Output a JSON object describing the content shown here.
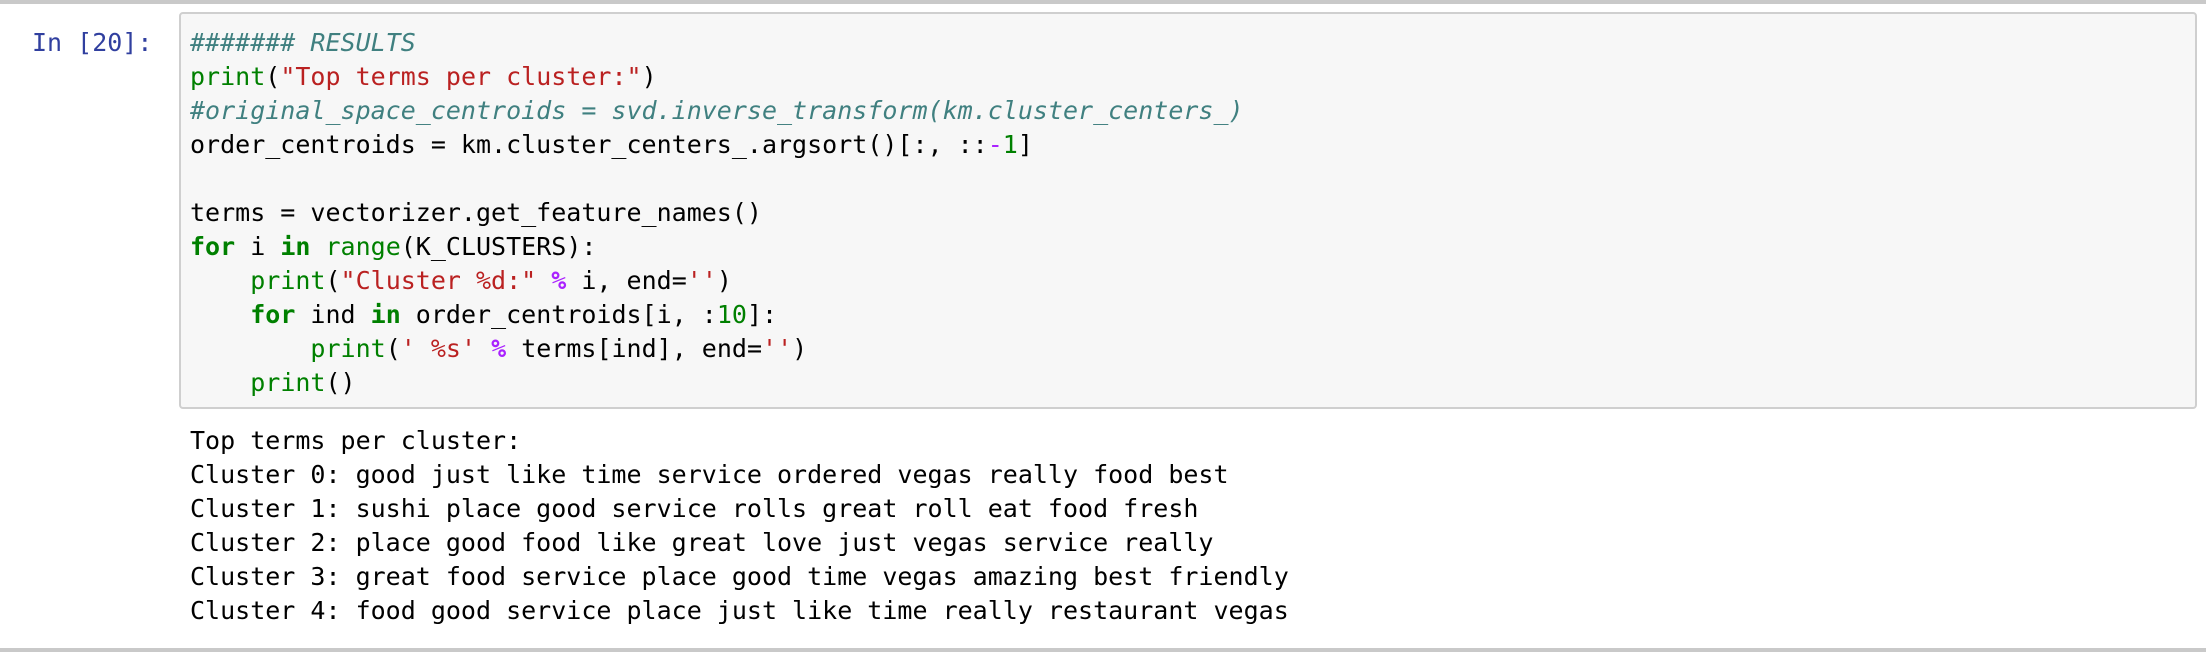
{
  "cell": {
    "prompt": "In [20]:",
    "code": {
      "comment_results": "####### RESULTS",
      "print_fn": "print",
      "open_paren": "(",
      "str_top_terms": "\"Top terms per cluster:\"",
      "close_paren": ")",
      "comment_original": "#original_space_centroids = svd.inverse_transform(km.cluster_centers_)",
      "order_prefix": "order_centroids = km.cluster_centers_.argsort()[:, ::",
      "minus": "-",
      "one": "1",
      "close_bracket": "]",
      "terms_line": "terms = vectorizer.get_feature_names()",
      "kw_for": "for",
      "var_i": " i ",
      "kw_in": "in",
      "space": " ",
      "range_fn": "range",
      "range_args": "(K_CLUSTERS):",
      "indent4": "    ",
      "indent8": "        ",
      "str_cluster": "\"Cluster %d:\"",
      "op_percent": "%",
      "print_args_i": " i, end=",
      "str_empty": "''",
      "var_ind": " ind ",
      "inner_for_rest": " order_centroids[i, :",
      "ten": "10",
      "inner_for_end": "]:",
      "str_term": "' %s'",
      "print_args_terms": " terms[ind], end=",
      "print_empty_call": "()"
    }
  },
  "output": {
    "lines": [
      "Top terms per cluster:",
      "Cluster 0: good just like time service ordered vegas really food best",
      "Cluster 1: sushi place good service rolls great roll eat food fresh",
      "Cluster 2: place good food like great love just vegas service really",
      "Cluster 3: great food service place good time vegas amazing best friendly",
      "Cluster 4: food good service place just like time really restaurant vegas"
    ]
  }
}
